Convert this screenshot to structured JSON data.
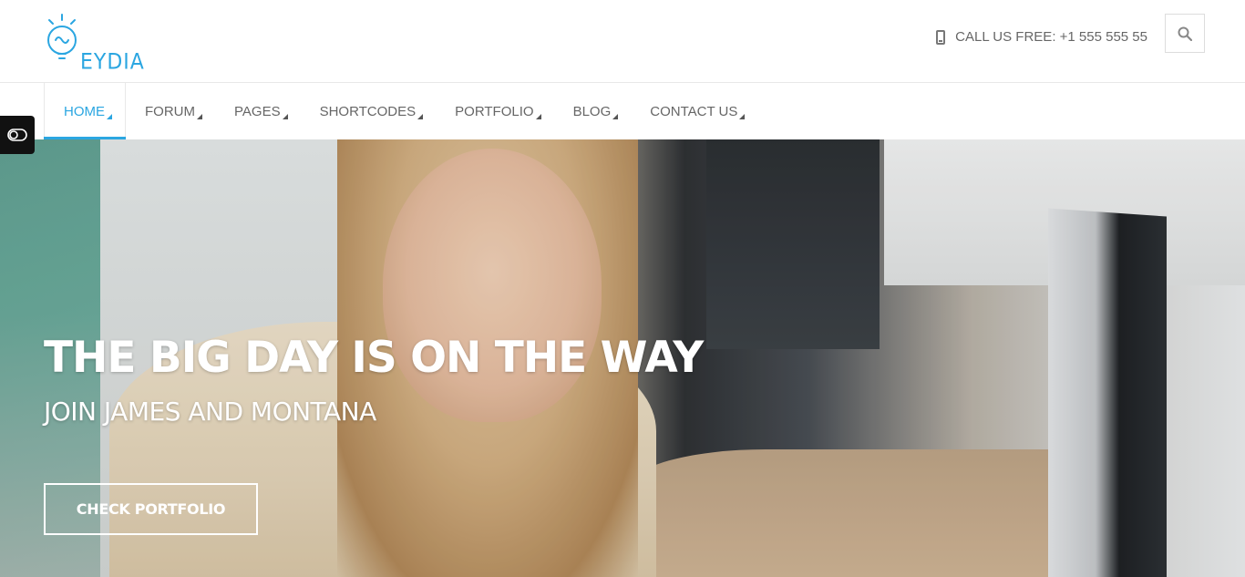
{
  "brand": {
    "logo_text": "EYDIA",
    "accent_color": "#2ba6e1"
  },
  "header": {
    "call_label": "CALL US FREE: +1 555 555 55",
    "phone_icon": "mobile-phone-icon",
    "search_icon": "search-icon"
  },
  "nav": {
    "items": [
      {
        "label": "HOME",
        "active": true
      },
      {
        "label": "FORUM"
      },
      {
        "label": "PAGES"
      },
      {
        "label": "SHORTCODES"
      },
      {
        "label": "PORTFOLIO"
      },
      {
        "label": "BLOG"
      },
      {
        "label": "CONTACT US"
      }
    ]
  },
  "hero": {
    "title": "THE BIG DAY IS ON THE WAY",
    "subtitle": "JOIN JAMES AND MONTANA",
    "button_label": "CHECK PORTFOLIO"
  },
  "side_toggle": {
    "icon": "toggle-switch-icon"
  }
}
